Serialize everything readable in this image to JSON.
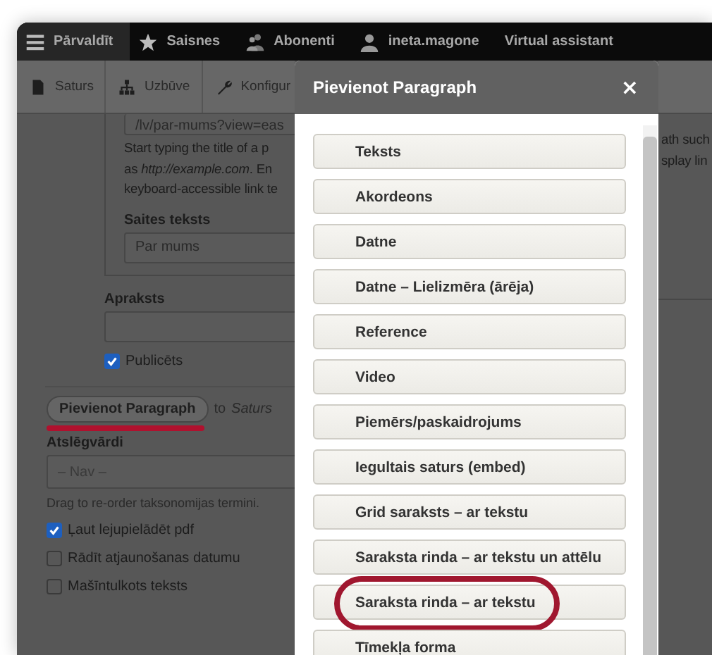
{
  "toolbar": [
    {
      "label": "Pārvaldīt",
      "selected": true
    },
    {
      "label": "Saisnes",
      "selected": false
    },
    {
      "label": "Abonenti",
      "selected": false
    },
    {
      "label": "ineta.magone",
      "selected": false
    },
    {
      "label": "Virtual assistant",
      "selected": false
    }
  ],
  "admin_menu": [
    {
      "label": "Saturs"
    },
    {
      "label": "Uzbūve"
    },
    {
      "label": "Konfigur"
    }
  ],
  "form": {
    "link_field": {
      "value": "/lv/par-mums?view=eas"
    },
    "description_lines": [
      "Start typing the title of a p",
      "as *http://example.com*. En",
      "keyboard-accessible link te"
    ],
    "description_right": [
      "ath such",
      "splay lin"
    ],
    "link_text": {
      "label": "Saites teksts",
      "value": "Par mums"
    },
    "summary": {
      "label": "Apraksts"
    },
    "published": {
      "label": "Publicēts",
      "checked": true
    },
    "add_paragraph": {
      "button": "Pievienot Paragraph",
      "to": "to",
      "target": "Saturs",
      "underlined": true
    },
    "keywords": {
      "label": "Atslēgvārdi",
      "value": "– Nav –",
      "hint": "Drag to re-order taksonomijas termini."
    },
    "options": [
      {
        "label": "Ļaut lejupielādēt pdf",
        "checked": true
      },
      {
        "label": "Rādīt atjaunošanas datumu",
        "checked": false
      },
      {
        "label": "Mašīntulkots teksts",
        "checked": false
      }
    ]
  },
  "dialog": {
    "title": "Pievienot Paragraph",
    "close": "×",
    "options": [
      {
        "label": "Teksts",
        "circled": false
      },
      {
        "label": "Akordeons",
        "circled": false
      },
      {
        "label": "Datne",
        "circled": false
      },
      {
        "label": "Datne – Lielizmēra (ārēja)",
        "circled": false
      },
      {
        "label": "Reference",
        "circled": false
      },
      {
        "label": "Video",
        "circled": false
      },
      {
        "label": "Piemērs/paskaidrojums",
        "circled": false
      },
      {
        "label": "Iegultais saturs (embed)",
        "circled": false
      },
      {
        "label": "Grid saraksts – ar tekstu",
        "circled": false
      },
      {
        "label": "Saraksta rinda – ar tekstu un attēlu",
        "circled": false
      },
      {
        "label": "Saraksta rinda – ar tekstu",
        "circled": true
      },
      {
        "label": "Tīmekļa forma",
        "circled": false
      }
    ]
  }
}
